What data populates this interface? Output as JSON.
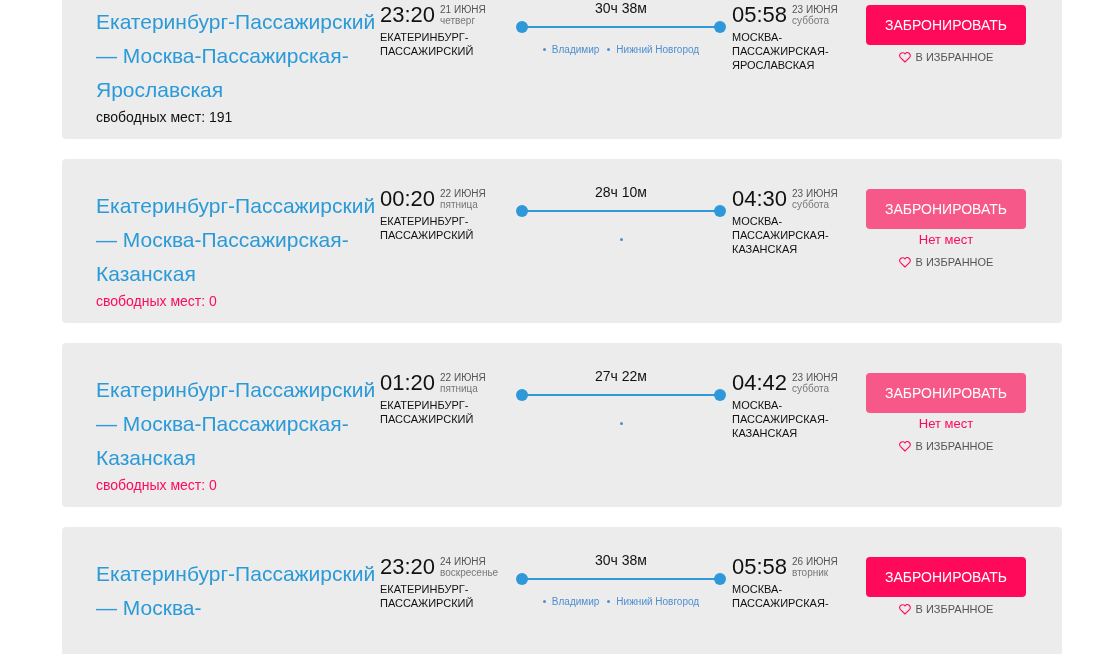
{
  "trips": [
    {
      "title": "Екатеринбург-Пассажирский — Москва-Пассажирская-Ярославская",
      "seats": "свободных мест: 191",
      "sold_out": false,
      "departure": {
        "time": "23:20",
        "date": "21 ИЮНЯ",
        "weekday": "четверг",
        "station": "ЕКАТЕРИНБУРГ-ПАССАЖИРСКИЙ"
      },
      "duration": "30ч 38м",
      "stops": [
        "Владимир",
        "Нижний Новгород"
      ],
      "arrival": {
        "time": "05:58",
        "date": "23 ИЮНЯ",
        "weekday": "суббота",
        "station": "МОСКВА-ПАССАЖИРСКАЯ-ЯРОСЛАВСКАЯ"
      },
      "button": "ЗАБРОНИРОВАТЬ",
      "favorite": "В ИЗБРАННОЕ"
    },
    {
      "title": "Екатеринбург-Пассажирский — Москва-Пассажирская-Казанская",
      "seats": "свободных мест: 0",
      "sold_out": true,
      "departure": {
        "time": "00:20",
        "date": "22 ИЮНЯ",
        "weekday": "пятница",
        "station": "ЕКАТЕРИНБУРГ-ПАССАЖИРСКИЙ"
      },
      "duration": "28ч 10м",
      "arrival": {
        "time": "04:30",
        "date": "23 ИЮНЯ",
        "weekday": "суббота",
        "station": "МОСКВА-ПАССАЖИРСКАЯ-КАЗАНСКАЯ"
      },
      "button": "ЗАБРОНИРОВАТЬ",
      "no_seats_note": "Нет мест",
      "favorite": "В ИЗБРАННОЕ"
    },
    {
      "title": "Екатеринбург-Пассажирский — Москва-Пассажирская-Казанская",
      "seats": "свободных мест: 0",
      "sold_out": true,
      "departure": {
        "time": "01:20",
        "date": "22 ИЮНЯ",
        "weekday": "пятница",
        "station": "ЕКАТЕРИНБУРГ-ПАССАЖИРСКИЙ"
      },
      "duration": "27ч 22м",
      "arrival": {
        "time": "04:42",
        "date": "23 ИЮНЯ",
        "weekday": "суббота",
        "station": "МОСКВА-ПАССАЖИРСКАЯ-КАЗАНСКАЯ"
      },
      "button": "ЗАБРОНИРОВАТЬ",
      "no_seats_note": "Нет мест",
      "favorite": "В ИЗБРАННОЕ"
    },
    {
      "title": "Екатеринбург-Пассажирский — Москва-",
      "sold_out": false,
      "departure": {
        "time": "23:20",
        "date": "24 ИЮНЯ",
        "weekday": "воскресенье",
        "station": "ЕКАТЕРИНБУРГ-ПАССАЖИРСКИЙ"
      },
      "duration": "30ч 38м",
      "stops": [
        "Владимир",
        "Нижний Новгород"
      ],
      "arrival": {
        "time": "05:58",
        "date": "26 ИЮНЯ",
        "weekday": "вторник",
        "station": "МОСКВА-ПАССАЖИРСКАЯ-"
      },
      "button": "ЗАБРОНИРОВАТЬ",
      "favorite": "В ИЗБРАННОЕ"
    }
  ]
}
